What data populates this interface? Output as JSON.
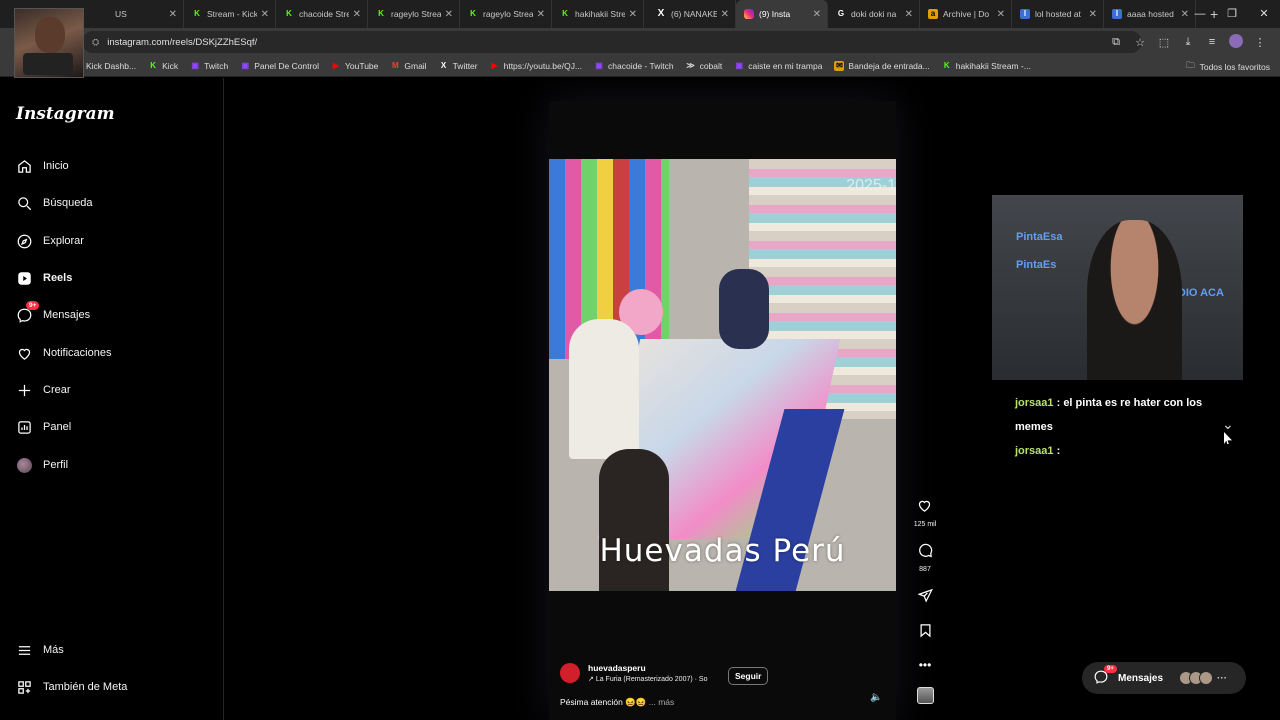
{
  "browser": {
    "tabs": [
      {
        "label": "US",
        "icon": "generic-tab-icon",
        "active": false
      },
      {
        "label": "Stream - Kick",
        "icon": "kick-icon",
        "active": false
      },
      {
        "label": "chacoide Stream",
        "icon": "kick-icon",
        "active": false
      },
      {
        "label": "rageylo Stream",
        "icon": "kick-icon",
        "active": false
      },
      {
        "label": "rageylo Stream",
        "icon": "kick-icon",
        "active": false
      },
      {
        "label": "hakihakii Stream",
        "icon": "kick-icon",
        "active": false
      },
      {
        "label": "(6) NANAKE",
        "icon": "x-icon",
        "active": false
      },
      {
        "label": "(9) Insta",
        "icon": "instagram-icon",
        "active": true
      },
      {
        "label": "doki doki na",
        "icon": "google-icon",
        "active": false
      },
      {
        "label": "Archive | Do",
        "icon": "archive-icon",
        "active": false
      },
      {
        "label": "lol hosted at",
        "icon": "lol-icon",
        "active": false
      },
      {
        "label": "aaaa hosted",
        "icon": "lol-icon",
        "active": false
      }
    ],
    "url": "instagram.com/reels/DSKjZZhESqf/",
    "bookmarks": [
      {
        "label": "Kick Dashb...",
        "icon": "kick-icon"
      },
      {
        "label": "Kick",
        "icon": "kick-icon"
      },
      {
        "label": "Twitch",
        "icon": "twitch-icon"
      },
      {
        "label": "Panel De Control",
        "icon": "twitch-icon"
      },
      {
        "label": "YouTube",
        "icon": "youtube-icon"
      },
      {
        "label": "Gmail",
        "icon": "gmail-icon"
      },
      {
        "label": "Twitter",
        "icon": "x-icon"
      },
      {
        "label": "https://youtu.be/QJ...",
        "icon": "youtube-icon"
      },
      {
        "label": "chacoide - Twitch",
        "icon": "twitch-icon"
      },
      {
        "label": "cobalt",
        "icon": "cobalt-icon"
      },
      {
        "label": "caiste en mi trampa",
        "icon": "twitch-icon"
      },
      {
        "label": "Bandeja de entrada...",
        "icon": "inbox-icon"
      },
      {
        "label": "hakihakii Stream -...",
        "icon": "kick-icon"
      }
    ],
    "all_favorites": "Todos los favoritos"
  },
  "sidebar": {
    "logo": "Instagram",
    "items": [
      {
        "label": "Inicio",
        "icon": "home-icon"
      },
      {
        "label": "Búsqueda",
        "icon": "search-icon"
      },
      {
        "label": "Explorar",
        "icon": "explore-compass-icon"
      },
      {
        "label": "Reels",
        "icon": "reels-icon"
      },
      {
        "label": "Mensajes",
        "icon": "messenger-icon",
        "badge": "9+"
      },
      {
        "label": "Notificaciones",
        "icon": "heart-icon"
      },
      {
        "label": "Crear",
        "icon": "plus-icon"
      },
      {
        "label": "Panel",
        "icon": "chart-icon"
      },
      {
        "label": "Perfil",
        "icon": "profile-avatar"
      }
    ],
    "bottom": [
      {
        "label": "Más",
        "icon": "menu-icon"
      },
      {
        "label": "También de Meta",
        "icon": "meta-icon"
      }
    ]
  },
  "reel": {
    "timestamp_overlay": "2025-1",
    "watermark": "Huevadas Perú",
    "likes": "125 mil",
    "comments": "887",
    "username": "huevadasperu",
    "song": "La Furia (Remasterizado 2007) · So",
    "follow_label": "Seguir",
    "caption": "Pésima atención 😖😖",
    "more_label": "... más"
  },
  "stream_overlay": {
    "lines": [
      "PintaEsa",
      "PintaEs",
      "AUDIO ACA"
    ],
    "chat": [
      {
        "user": "jorsaa1",
        "text": ": el pinta es re hater con los memes"
      },
      {
        "user": "jorsaa1",
        "text": ":"
      }
    ]
  },
  "messages_pill": {
    "label": "Mensajes",
    "badge": "9+"
  }
}
